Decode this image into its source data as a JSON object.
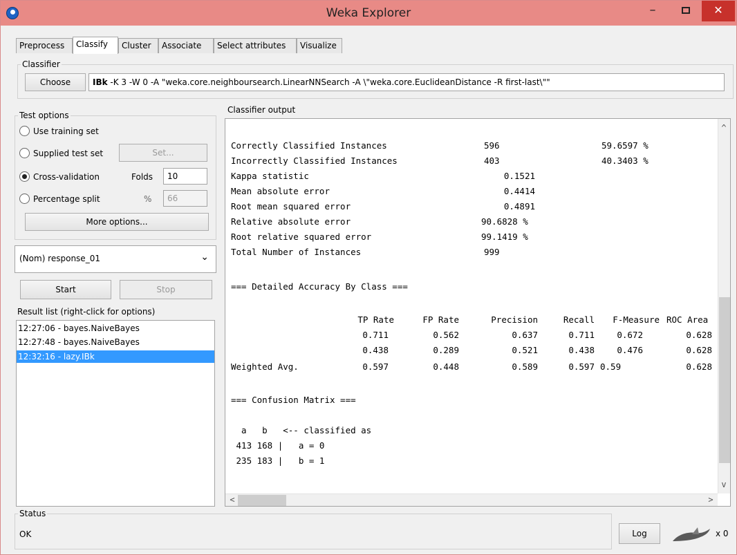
{
  "window": {
    "title": "Weka Explorer",
    "minimize_glyph": "–",
    "close_glyph": "✕"
  },
  "tabs": [
    "Preprocess",
    "Classify",
    "Cluster",
    "Associate",
    "Select attributes",
    "Visualize"
  ],
  "active_tab": "Classify",
  "classifier": {
    "group_label": "Classifier",
    "choose_label": "Choose",
    "name": "IBk",
    "options": " -K 3 -W 0 -A \"weka.core.neighboursearch.LinearNNSearch -A \\\"weka.core.EuclideanDistance -R first-last\\\"\""
  },
  "test_options": {
    "group_label": "Test options",
    "use_training_set": "Use training set",
    "supplied_test_set": "Supplied test set",
    "set_button": "Set...",
    "cross_validation": "Cross-validation",
    "folds_label": "Folds",
    "folds_value": "10",
    "percentage_split": "Percentage split",
    "percent_symbol": "%",
    "percent_value": "66",
    "more_options": "More options...",
    "selected": "cross_validation"
  },
  "class_attribute": {
    "value": "(Nom) response_01",
    "chevron": "⌄"
  },
  "controls": {
    "start": "Start",
    "stop": "Stop"
  },
  "result_list": {
    "label": "Result list (right-click for options)",
    "items": [
      "12:27:06 - bayes.NaiveBayes",
      "12:27:48 - bayes.NaiveBayes",
      "12:32:16 - lazy.IBk"
    ],
    "selected_index": 2
  },
  "output": {
    "label": "Classifier output",
    "summary": [
      [
        "Correctly Classified Instances",
        "596",
        "59.6597 %"
      ],
      [
        "Incorrectly Classified Instances",
        "403",
        "40.3403 %"
      ],
      [
        "Kappa statistic",
        "0.1521",
        ""
      ],
      [
        "Mean absolute error",
        "0.4414",
        ""
      ],
      [
        "Root mean squared error",
        "0.4891",
        ""
      ],
      [
        "Relative absolute error",
        "90.6828 %",
        ""
      ],
      [
        "Root relative squared error",
        "99.1419 %",
        ""
      ],
      [
        "Total Number of Instances",
        "999",
        ""
      ]
    ],
    "accuracy_heading": "=== Detailed Accuracy By Class ===",
    "accuracy_columns": [
      "TP Rate",
      "FP Rate",
      "Precision",
      "Recall",
      "F-Measure",
      "ROC Area"
    ],
    "accuracy_rows": [
      [
        "",
        "0.711",
        "0.562",
        "0.637",
        "0.711",
        "0.672",
        "0.628"
      ],
      [
        "",
        "0.438",
        "0.289",
        "0.521",
        "0.438",
        "0.476",
        "0.628"
      ],
      [
        "Weighted Avg.",
        "0.597",
        "0.448",
        "0.589",
        "0.597",
        "0.59",
        "0.628"
      ]
    ],
    "confusion_heading": "=== Confusion Matrix ===",
    "confusion_lines": [
      "  a   b   <-- classified as",
      " 413 168 |   a = 0",
      " 235 183 |   b = 1"
    ],
    "scroll_up": "^",
    "scroll_down": "v",
    "scroll_left": "<",
    "scroll_right": ">"
  },
  "status": {
    "label": "Status",
    "text": "OK",
    "log_button": "Log",
    "task_count": "x 0"
  }
}
